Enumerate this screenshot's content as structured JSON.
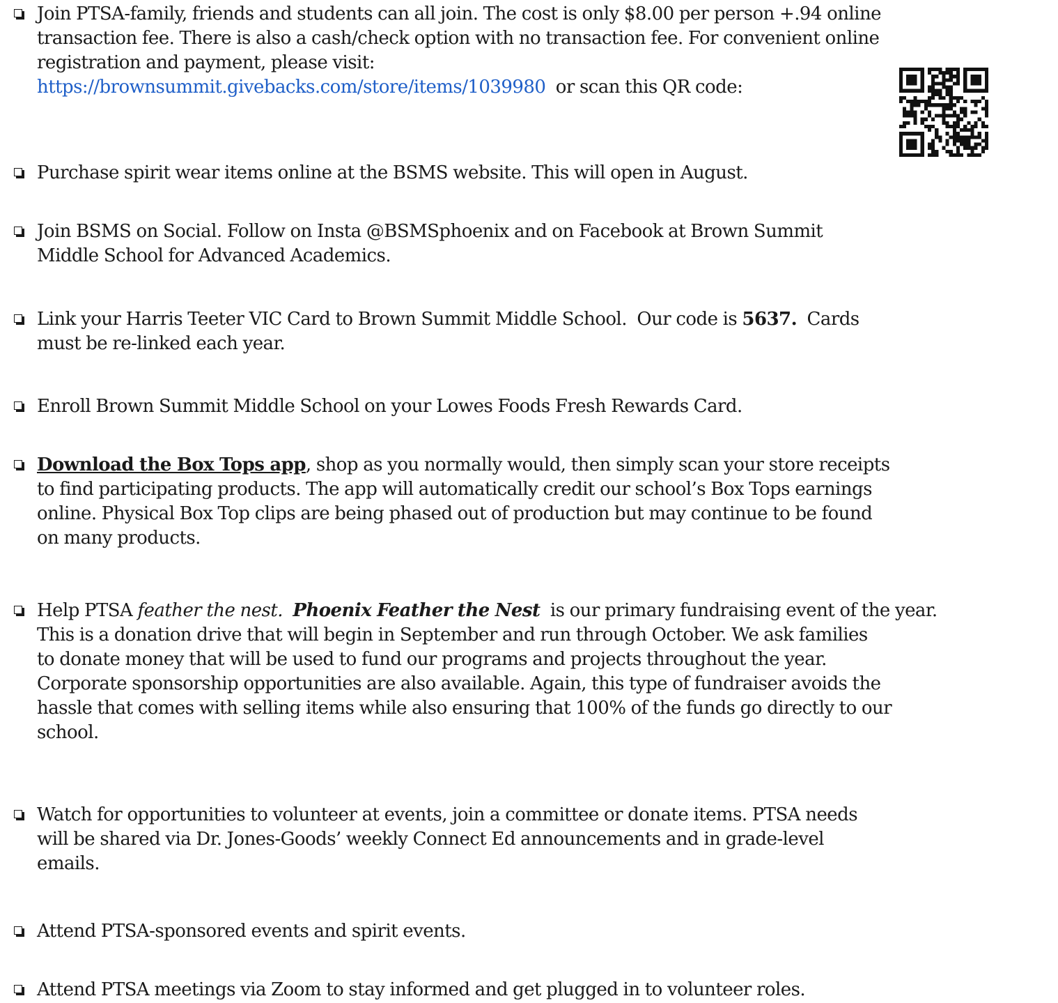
{
  "items": [
    {
      "lines": [
        "Join PTSA-family, friends and students can all join.  The cost is only $8.00 per person +.94 online",
        "transaction fee. There is also a cash/check option with no transaction fee. For convenient online",
        "registration and payment, please visit:"
      ],
      "link": "https://brownsummit.givebacks.com/store/items/1039980",
      "after_link": "  or scan this QR code:"
    },
    {
      "lines": [
        "Purchase spirit wear items online at the BSMS website. This will open in August."
      ]
    },
    {
      "lines": [
        "Join BSMS on Social. Follow on Insta @BSMSphoenix and on Facebook at Brown Summit",
        "Middle School for Advanced Academics."
      ]
    },
    {
      "line1_pre": "Link your Harris Teeter VIC Card to Brown Summit Middle School.  Our code is ",
      "code": "5637.",
      "line1_post": "  Cards",
      "line2": "must be re-linked each year."
    },
    {
      "lines": [
        "Enroll Brown Summit Middle School on your Lowes Foods Fresh Rewards Card."
      ]
    },
    {
      "link_text": "Download the Box Tops app",
      "line1_post": ", shop as you normally would, then simply scan your store receipts",
      "lines": [
        "to find participating products.  The app will automatically credit our school’s Box Tops earnings",
        "online.  Physical Box Top clips are being phased out of production but may continue to be found",
        "on many products."
      ]
    },
    {
      "pre": "Help PTSA ",
      "italic": "feather the nest.",
      "space": "  ",
      "event": "Phoenix Feather the Nest",
      "post": "  is our primary fundraising event of the year.",
      "lines": [
        "This is a donation drive that will begin in September and run through October.  We ask families",
        "to donate money that will be used to fund our programs and projects throughout the year.",
        "Corporate sponsorship opportunities are also available.  Again, this type of fundraiser avoids the",
        "hassle that comes with selling items while also ensuring that 100% of the funds go directly to our",
        "school."
      ]
    },
    {
      "lines": [
        "Watch for opportunities to volunteer at events, join a committee or donate items.  PTSA needs",
        "will be shared via Dr. Jones-Goods’ weekly Connect Ed announcements and in grade-level",
        "emails."
      ]
    },
    {
      "lines": [
        "Attend PTSA-sponsored events and spirit events."
      ]
    },
    {
      "lines": [
        "Attend PTSA meetings via Zoom to stay informed and get plugged in to volunteer roles."
      ]
    }
  ],
  "colors": {
    "text": "#1a1a1a",
    "link": "#1f5fc8"
  },
  "icons": [
    "checkbox-icon",
    "qr-code-icon"
  ]
}
